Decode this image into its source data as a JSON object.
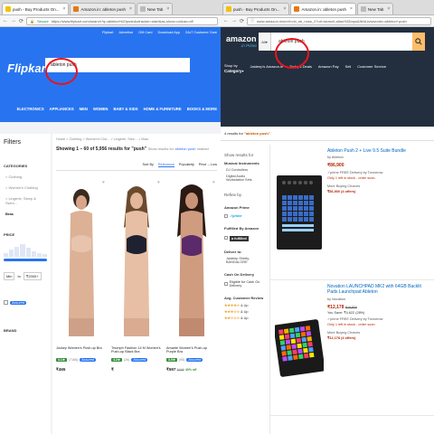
{
  "left_window": {
    "tabs": [
      {
        "label": "push - Buy Products On...",
        "favicon_color": "#f4c100",
        "active": true
      },
      {
        "label": "Amazon.in: ableton push",
        "favicon_color": "#e47911",
        "active": false
      },
      {
        "label": "New Tab",
        "favicon_color": "#bbbbbb",
        "active": false
      }
    ],
    "address": {
      "secure_label": "Secure",
      "url": "https://www.flipkart.com/search?q=ableton%20push&otracker=start&as-show=on&as=off"
    },
    "header_links": [
      "Flipkart",
      "Advertise",
      "Gift Card",
      "Download App",
      "24x7 Customer Care"
    ],
    "logo": "Flipkart",
    "search_value": "ableton push",
    "categories": [
      "ELECTRONICS",
      "APPLIANCES",
      "MEN",
      "WOMEN",
      "BABY & KIDS",
      "HOME & FURNITURE",
      "BOOKS & MORE"
    ],
    "filters": {
      "title": "Filters",
      "categories_label": "CATEGORIES",
      "category_items": [
        "< Clothing",
        "< Women's Clothing",
        "< Lingerie, Sleep & Swim...",
        "Bras"
      ],
      "price_label": "PRICE",
      "price_min": "Min",
      "price_to": "to",
      "price_max": "₹2000+",
      "assured_label": "Assured",
      "brand_label": "BRAND"
    },
    "breadcrumb": "Home > Clothing > Women's Clot... > Lingerie, Slee... > Bras",
    "results": {
      "showing": "Showing 1 – 60 of 5,956 results for \"push\"",
      "show_instead": "Show results for",
      "instead_link": "ableton push",
      "instead_suffix": "instead"
    },
    "sort": {
      "label": "Sort By",
      "options": [
        "Relevance",
        "Popularity",
        "Price -- Low"
      ]
    },
    "products": [
      {
        "name": "Jockey Women's Push-up Bra",
        "rating": "4.1★",
        "count": "(7166)",
        "price": "₹465",
        "mrp": "",
        "discount": ""
      },
      {
        "name": "Triumph Fashion 14 M Women's Push-up Black Bra",
        "rating": "4.2★",
        "count": "(26)",
        "price": "₹",
        "mrp": "",
        "discount": ""
      },
      {
        "name": "Amante Women's Push-up Purple Bra",
        "rating": "3.9★",
        "count": "(95)",
        "price": "₹597",
        "mrp": "₹995",
        "discount": "40% off"
      }
    ]
  },
  "right_window": {
    "tabs": [
      {
        "label": "push - Buy Products On...",
        "favicon_color": "#f4c100",
        "active": false
      },
      {
        "label": "Amazon.in: ableton push",
        "favicon_color": "#e47911",
        "active": true
      },
      {
        "label": "New Tab",
        "favicon_color": "#bbbbbb",
        "active": false
      }
    ],
    "address": {
      "url": "www.amazon.in/s/ref=nb_sb_noss_2?url=search-alias%3Daps&field-keywords=ableton+push"
    },
    "logo": "amazon",
    "logo_sub": ".in Prime",
    "search_scope": "All",
    "search_value": "ableton push",
    "shop_by": "Shop by",
    "category": "Category",
    "nav": [
      "Jaideep's Amazon.in",
      "Today's Deals",
      "Amazon Pay",
      "Sell",
      "Customer Service"
    ],
    "results_prefix": "4 results for",
    "results_query": "\"ableton push\"",
    "sidebar": {
      "show_results_for": "Show results for",
      "musical_instruments": "Musical Instruments",
      "mi_items": [
        "DJ Controllers",
        "Digital Audio Workstation Sets"
      ],
      "refine_by": "Refine by",
      "amazon_prime": "Amazon Prime",
      "prime_logo": "✓prime",
      "fulfilled_by": "Fulfilled By Amazon",
      "fulfilled_badge": "a fulfilled",
      "deliver_to": "Deliver to:",
      "deliver_loc": "Jaideep Shetty- BANGALORE",
      "cod": "Cash On Delivery",
      "cod_item": "Eligible for Cash On Delivery",
      "avg_review": "Avg. Customer Review",
      "star_rows": [
        {
          "stars": "★★★★☆",
          "label": "& Up"
        },
        {
          "stars": "★★★☆☆",
          "label": "& Up"
        },
        {
          "stars": "★★☆☆☆",
          "label": "& Up"
        }
      ]
    },
    "items": [
      {
        "title": "Ableton Push 2 + Live 9.5 Suite Bundle",
        "by": "by Ableton",
        "price": "₹86,900",
        "mrp": "",
        "save": "",
        "ship": "✓prime FREE Delivery by Tomorrow",
        "stock": "Only 1 left in stock - order soon.",
        "more": "More Buying Choices",
        "more_price": "₹86,900 (4 offers)"
      },
      {
        "title": "Novation LAUNCHPAD MK2 with 64GB Backlit Pads Launchpad Ableton",
        "by": "by Novation",
        "price": "₹12,178",
        "mrp": "₹16,800",
        "save": "You Save: ₹4,622 (28%)",
        "ship": "✓prime FREE Delivery by Tomorrow",
        "stock": "Only 1 left in stock - order soon.",
        "more": "More Buying Choices",
        "more_price": "₹12,178 (4 offers)"
      }
    ]
  },
  "colors": {
    "flipkart_blue": "#2874f0",
    "amazon_dark": "#232f3e",
    "amazon_orange": "#febd69",
    "highlight_red": "#e8141c"
  }
}
